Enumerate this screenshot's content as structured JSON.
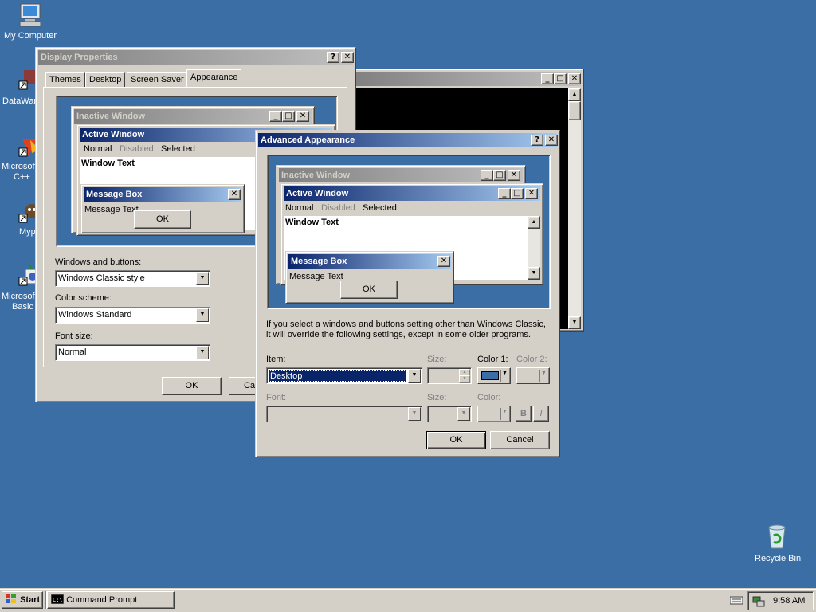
{
  "desktop": {
    "icons": [
      {
        "name": "my-computer",
        "label": "My Computer"
      },
      {
        "name": "datawarehouse",
        "label": "DataWar"
      },
      {
        "name": "ms-cpp",
        "label1": "Microsoft",
        "label2": "C++"
      },
      {
        "name": "myp",
        "label": "Myp"
      },
      {
        "name": "ms-basic",
        "label1": "Microsoft",
        "label2": "Basic"
      },
      {
        "name": "recycle-bin",
        "label": "Recycle Bin"
      }
    ]
  },
  "display_properties": {
    "title": "Display Properties",
    "tabs": [
      "Themes",
      "Desktop",
      "Screen Saver",
      "Appearance"
    ],
    "preview": {
      "inactive_title": "Inactive Window",
      "active_title": "Active Window",
      "menu": [
        "Normal",
        "Disabled",
        "Selected"
      ],
      "window_text": "Window Text",
      "msgbox_title": "Message Box",
      "msgbox_text": "Message Text",
      "ok": "OK"
    },
    "windows_buttons_label": "Windows and buttons:",
    "windows_buttons_value": "Windows Classic style",
    "color_scheme_label": "Color scheme:",
    "color_scheme_value": "Windows Standard",
    "font_size_label": "Font size:",
    "font_size_value": "Normal",
    "ok": "OK",
    "cancel": "Car"
  },
  "advanced": {
    "title": "Advanced Appearance",
    "preview": {
      "inactive_title": "Inactive Window",
      "active_title": "Active Window",
      "menu": [
        "Normal",
        "Disabled",
        "Selected"
      ],
      "window_text": "Window Text",
      "msgbox_title": "Message Box",
      "msgbox_text": "Message Text",
      "ok": "OK"
    },
    "info_line1": "If you select a windows and buttons setting other than Windows Classic,",
    "info_line2": "it will override the following settings, except in some older programs.",
    "item_label": "Item:",
    "item_value": "Desktop",
    "size_label": "Size:",
    "color1_label": "Color 1:",
    "color2_label": "Color 2:",
    "font_label": "Font:",
    "font_size_label": "Size:",
    "font_color_label": "Color:",
    "bold": "B",
    "italic": "I",
    "ok": "OK",
    "cancel": "Cancel",
    "color1": "#3a6ea5"
  },
  "taskbar": {
    "start": "Start",
    "task": "Command Prompt",
    "time": "9:58 AM"
  },
  "colors": {
    "desktop": "#3a6ea5",
    "active_title": "#0a246a",
    "face": "#d4d0c8"
  }
}
